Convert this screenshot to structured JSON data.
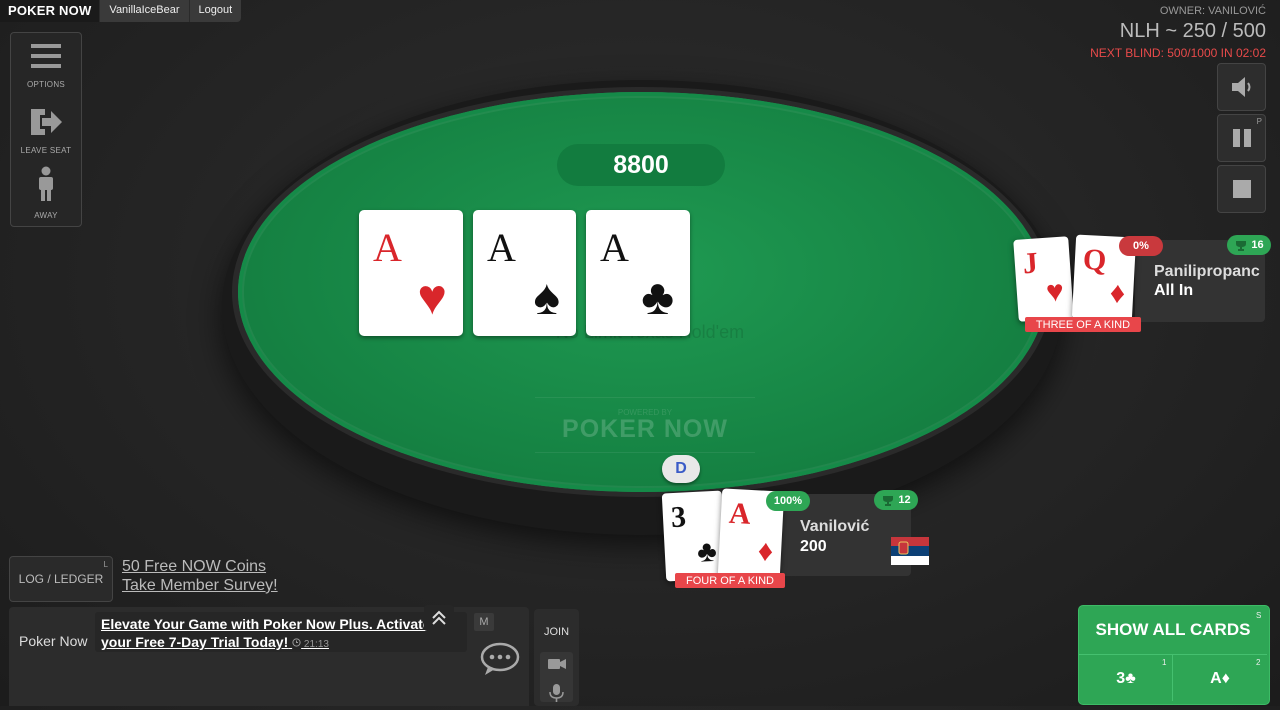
{
  "topbar": {
    "brand": "POKER NOW",
    "user": "VanillaIceBear",
    "logout": "Logout"
  },
  "left_menu": {
    "options": "OPTIONS",
    "leave_seat": "LEAVE SEAT",
    "away": "AWAY"
  },
  "game_info": {
    "owner": "OWNER: VANILOVIĆ",
    "blinds": "NLH ~ 250 / 500",
    "next_blind": "NEXT BLIND: 500/1000 IN 02:02"
  },
  "right_controls": {
    "pause_hotkey": "P"
  },
  "table": {
    "pot": "8800",
    "game_type": "No Limit Texas Hold'em",
    "powered_by": "POWERED BY",
    "logo": "POKER NOW",
    "dealer": "D",
    "community_cards": [
      {
        "rank": "A",
        "suit": "♥",
        "color": "red"
      },
      {
        "rank": "A",
        "suit": "♠",
        "color": "black"
      },
      {
        "rank": "A",
        "suit": "♣",
        "color": "black"
      }
    ]
  },
  "players": {
    "opponent": {
      "name": "Panilipropanc",
      "stack": "All In",
      "equity": "0%",
      "wins": "16",
      "hand_label": "THREE OF A KIND",
      "cards": [
        {
          "rank": "J",
          "suit": "♥",
          "color": "red"
        },
        {
          "rank": "Q",
          "suit": "♦",
          "color": "red"
        }
      ]
    },
    "hero": {
      "name": "Vanilović",
      "stack": "200",
      "equity": "100%",
      "wins": "12",
      "hand_label": "FOUR OF A KIND",
      "cards": [
        {
          "rank": "3",
          "suit": "♣",
          "color": "black"
        },
        {
          "rank": "A",
          "suit": "♦",
          "color": "red"
        }
      ]
    }
  },
  "bottom": {
    "log_ledger": "LOG / LEDGER",
    "log_hotkey": "L",
    "promo1": "50 Free NOW Coins",
    "promo2": "Take Member Survey!",
    "chat_sender": "Poker Now",
    "chat_message": "Elevate Your Game with Poker Now Plus. Activate your Free 7-Day Trial Today!",
    "chat_time": "21:13",
    "mute_hotkey": "M",
    "join": "JOIN"
  },
  "show_cards": {
    "label": "SHOW ALL CARDS",
    "hotkey": "S",
    "card1": "3♣",
    "card1_hotkey": "1",
    "card2": "A♦",
    "card2_hotkey": "2"
  },
  "colors": {
    "felt": "#168444",
    "accent_green": "#2ea655",
    "alert_red": "#e84a4a",
    "hand_label_red": "#e8464a"
  }
}
